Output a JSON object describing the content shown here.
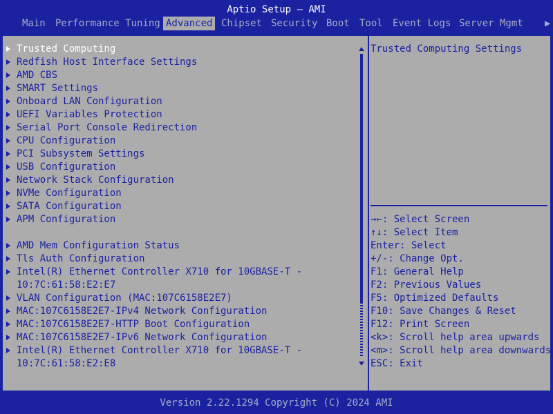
{
  "header": {
    "title": "Aptio Setup – AMI",
    "tabs": [
      {
        "label": "Main"
      },
      {
        "label": "Performance Tuning"
      },
      {
        "label": "Advanced"
      },
      {
        "label": "Chipset"
      },
      {
        "label": "Security"
      },
      {
        "label": "Boot"
      },
      {
        "label": "Tool"
      },
      {
        "label": "Event Logs"
      },
      {
        "label": "Server Mgmt"
      }
    ],
    "active_tab": "Advanced",
    "more_indicator": "▶"
  },
  "menu": {
    "items": [
      "Trusted Computing",
      "Redfish Host Interface Settings",
      "AMD CBS",
      "SMART Settings",
      "Onboard LAN Configuration",
      "UEFI Variables Protection",
      "Serial Port Console Redirection",
      "CPU Configuration",
      "PCI Subsystem Settings",
      "USB Configuration",
      "Network Stack Configuration",
      "NVMe Configuration",
      "SATA Configuration",
      "APM Configuration",
      "",
      "AMD Mem Configuration Status",
      "Tls Auth Configuration",
      "Intel(R) Ethernet Controller X710 for 10GBASE-T -",
      "10:7C:61:58:E2:E7",
      "VLAN Configuration (MAC:107C6158E2E7)",
      "MAC:107C6158E2E7-IPv4 Network Configuration",
      "MAC:107C6158E2E7-HTTP Boot Configuration",
      "MAC:107C6158E2E7-IPv6 Network Configuration",
      "Intel(R) Ethernet Controller X710 for 10GBASE-T -",
      "10:7C:61:58:E2:E8"
    ],
    "selected_index": 0
  },
  "help": {
    "description": "Trusted Computing Settings",
    "keys": [
      "→←: Select Screen",
      "↑↓: Select Item",
      "Enter: Select",
      "+/-: Change Opt.",
      "F1: General Help",
      "F2: Previous Values",
      "F5: Optimized Defaults",
      "F10: Save Changes & Reset",
      "F12: Print Screen",
      "<k>: Scroll help area upwards",
      "<m>: Scroll help area downwards",
      "ESC: Exit"
    ]
  },
  "footer": {
    "version": "Version 2.22.1294 Copyright (C) 2024 AMI"
  },
  "colors": {
    "background": "#1a22a0",
    "panel": "#acacac",
    "text_dark": "#1a22a0",
    "text_highlight": "#ffffff",
    "text_dim": "#a8acc8"
  }
}
